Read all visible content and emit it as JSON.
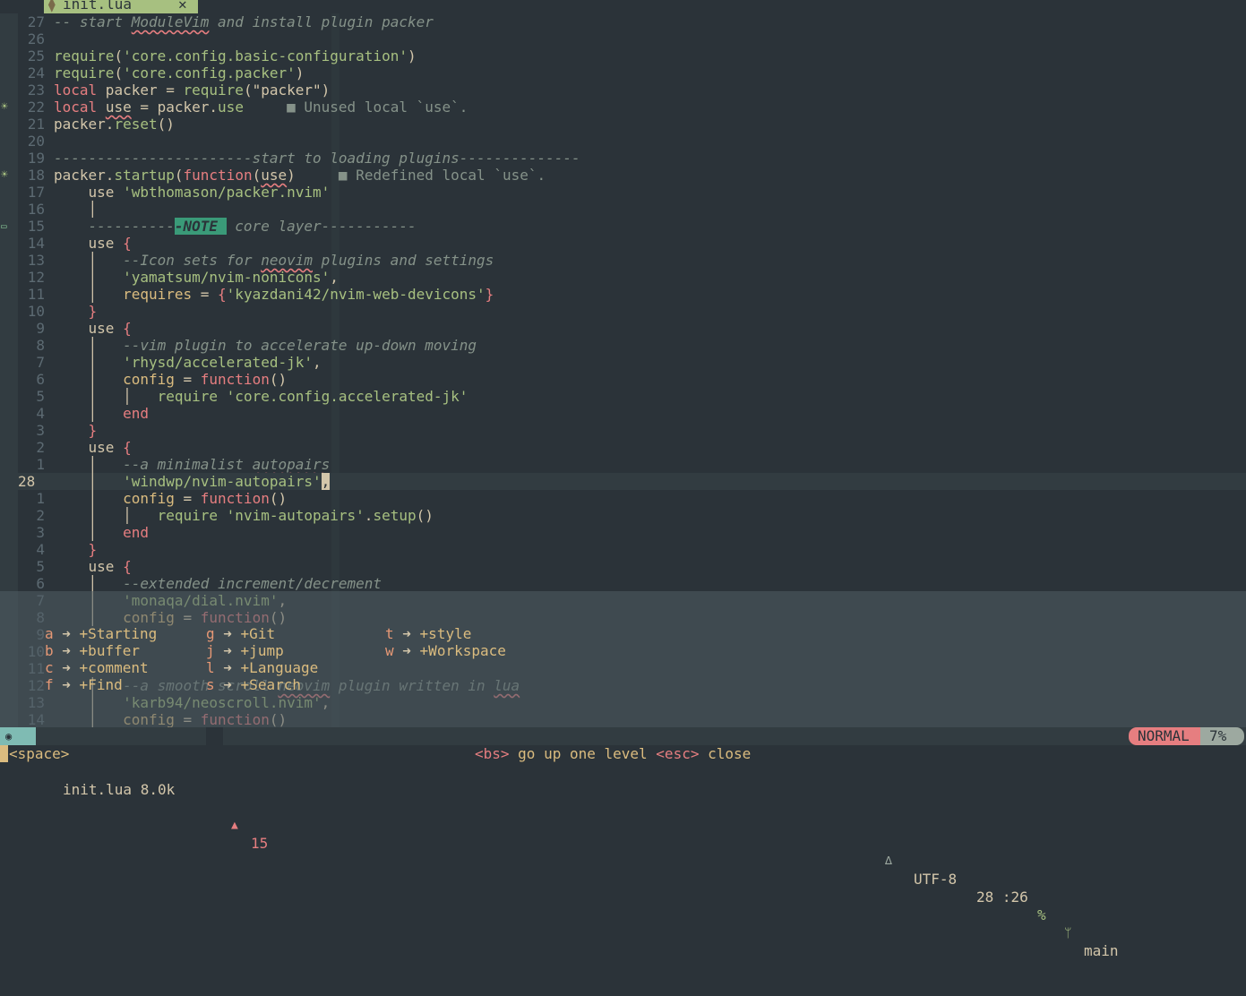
{
  "tab": {
    "icon": "lua-file-icon",
    "name": "init.lua",
    "close": "✕"
  },
  "lines": [
    {
      "num": "27",
      "sign": "",
      "segs": [
        [
          "cm",
          "-- start "
        ],
        [
          "cm uline",
          "ModuleVim"
        ],
        [
          "cm",
          " and install plugin packer"
        ]
      ]
    },
    {
      "num": "26",
      "sign": "",
      "segs": []
    },
    {
      "num": "25",
      "sign": "",
      "segs": [
        [
          "fn",
          "require"
        ],
        [
          "pl",
          "("
        ],
        [
          "str",
          "'core.config.basic-configuration'"
        ],
        [
          "pl",
          ")"
        ]
      ]
    },
    {
      "num": "24",
      "sign": "",
      "segs": [
        [
          "fn",
          "require"
        ],
        [
          "pl",
          "("
        ],
        [
          "str",
          "'core.config.packer'"
        ],
        [
          "pl",
          ")"
        ]
      ]
    },
    {
      "num": "23",
      "sign": "",
      "segs": [
        [
          "kw",
          "local"
        ],
        [
          "pl",
          " packer = "
        ],
        [
          "fn",
          "require"
        ],
        [
          "pl",
          "(\"packer\")"
        ]
      ]
    },
    {
      "num": "22",
      "sign": "☀",
      "segs": [
        [
          "kw",
          "local"
        ],
        [
          "pl",
          " "
        ],
        [
          "pl uline",
          "use"
        ],
        [
          "pl",
          " = packer."
        ],
        [
          "fn",
          "use"
        ],
        [
          "diag",
          "     ■ Unused local `use`."
        ]
      ]
    },
    {
      "num": "21",
      "sign": "",
      "segs": [
        [
          "pl",
          "packer."
        ],
        [
          "fn",
          "reset"
        ],
        [
          "pl",
          "()"
        ]
      ]
    },
    {
      "num": "20",
      "sign": "",
      "segs": []
    },
    {
      "num": "19",
      "sign": "",
      "segs": [
        [
          "cm",
          "-----------------------start to loading plugins--------------"
        ]
      ]
    },
    {
      "num": "18",
      "sign": "☀",
      "segs": [
        [
          "pl",
          "packer."
        ],
        [
          "fn",
          "startup"
        ],
        [
          "pl",
          "("
        ],
        [
          "kw",
          "function"
        ],
        [
          "pl",
          "("
        ],
        [
          "pl uline",
          "use"
        ],
        [
          "pl",
          ")"
        ],
        [
          "diag",
          "     ■ Redefined local `use`."
        ]
      ]
    },
    {
      "num": "17",
      "sign": "",
      "segs": [
        [
          "pl",
          "    use "
        ],
        [
          "str",
          "'wbthomason/packer.nvim'"
        ]
      ]
    },
    {
      "num": "16",
      "sign": "",
      "segs": [
        [
          "pl",
          "    │"
        ]
      ]
    },
    {
      "num": "15",
      "sign": "note",
      "segs": [
        [
          "pl",
          "    "
        ],
        [
          "cm",
          "----------"
        ],
        [
          "note",
          "-NOTE "
        ],
        [
          "cm",
          " core layer-----------"
        ]
      ]
    },
    {
      "num": "14",
      "sign": "",
      "segs": [
        [
          "pl",
          "    use "
        ],
        [
          "br",
          "{"
        ]
      ]
    },
    {
      "num": "13",
      "sign": "",
      "segs": [
        [
          "pl",
          "    │   "
        ],
        [
          "cm",
          "--Icon sets for "
        ],
        [
          "cm uline",
          "neovim"
        ],
        [
          "cm",
          " plugins and settings"
        ]
      ]
    },
    {
      "num": "12",
      "sign": "",
      "segs": [
        [
          "pl",
          "    │   "
        ],
        [
          "str",
          "'yamatsum/nvim-nonicons'"
        ],
        [
          "pl",
          ","
        ]
      ]
    },
    {
      "num": "11",
      "sign": "",
      "segs": [
        [
          "pl",
          "    │   "
        ],
        [
          "yl",
          "requires"
        ],
        [
          "pl",
          " = "
        ],
        [
          "br",
          "{"
        ],
        [
          "str",
          "'kyazdani42/nvim-web-devicons'"
        ],
        [
          "br",
          "}"
        ]
      ]
    },
    {
      "num": "10",
      "sign": "",
      "segs": [
        [
          "pl",
          "    "
        ],
        [
          "br",
          "}"
        ]
      ]
    },
    {
      "num": "9",
      "sign": "",
      "segs": [
        [
          "pl",
          "    use "
        ],
        [
          "br",
          "{"
        ]
      ]
    },
    {
      "num": "8",
      "sign": "",
      "segs": [
        [
          "pl",
          "    │   "
        ],
        [
          "cm",
          "--vim plugin to accelerate up-down moving"
        ]
      ]
    },
    {
      "num": "7",
      "sign": "",
      "segs": [
        [
          "pl",
          "    │   "
        ],
        [
          "str",
          "'rhysd/accelerated-jk'"
        ],
        [
          "pl",
          ","
        ]
      ]
    },
    {
      "num": "6",
      "sign": "",
      "segs": [
        [
          "pl",
          "    │   "
        ],
        [
          "yl",
          "config"
        ],
        [
          "pl",
          " = "
        ],
        [
          "kw",
          "function"
        ],
        [
          "pl",
          "()"
        ]
      ]
    },
    {
      "num": "5",
      "sign": "",
      "segs": [
        [
          "pl",
          "    │   │   "
        ],
        [
          "fn",
          "require"
        ],
        [
          "pl",
          " "
        ],
        [
          "str",
          "'core.config.accelerated-jk'"
        ]
      ]
    },
    {
      "num": "4",
      "sign": "",
      "segs": [
        [
          "pl",
          "    │   "
        ],
        [
          "kw",
          "end"
        ]
      ]
    },
    {
      "num": "3",
      "sign": "",
      "segs": [
        [
          "pl",
          "    "
        ],
        [
          "br",
          "}"
        ]
      ]
    },
    {
      "num": "2",
      "sign": "",
      "segs": [
        [
          "pl",
          "    use "
        ],
        [
          "br",
          "{"
        ]
      ]
    },
    {
      "num": "1",
      "sign": "",
      "segs": [
        [
          "pl",
          "    │   "
        ],
        [
          "cm",
          "--a minimalist "
        ],
        [
          "cm uline",
          "autopairs"
        ]
      ]
    },
    {
      "num": "28",
      "sign": "",
      "cur": true,
      "segs": [
        [
          "pl",
          "    │   "
        ],
        [
          "str",
          "'windwp/nvim-autopairs'"
        ],
        [
          "cursor",
          ","
        ]
      ]
    },
    {
      "num": "1",
      "sign": "",
      "segs": [
        [
          "pl",
          "    │   "
        ],
        [
          "yl",
          "config"
        ],
        [
          "pl",
          " = "
        ],
        [
          "kw",
          "function"
        ],
        [
          "pl",
          "()"
        ]
      ]
    },
    {
      "num": "2",
      "sign": "",
      "segs": [
        [
          "pl",
          "    │   │   "
        ],
        [
          "fn",
          "require"
        ],
        [
          "pl",
          " "
        ],
        [
          "str",
          "'nvim-autopairs'"
        ],
        [
          "pl",
          "."
        ],
        [
          "fn",
          "setup"
        ],
        [
          "pl",
          "()"
        ]
      ]
    },
    {
      "num": "3",
      "sign": "",
      "segs": [
        [
          "pl",
          "    │   "
        ],
        [
          "kw",
          "end"
        ]
      ]
    },
    {
      "num": "4",
      "sign": "",
      "segs": [
        [
          "pl",
          "    "
        ],
        [
          "br",
          "}"
        ]
      ]
    },
    {
      "num": "5",
      "sign": "",
      "segs": [
        [
          "pl",
          "    use "
        ],
        [
          "br",
          "{"
        ]
      ]
    },
    {
      "num": "6",
      "sign": "",
      "segs": [
        [
          "pl",
          "    │   "
        ],
        [
          "cm",
          "--extended increment/decrement"
        ]
      ]
    },
    {
      "num": "7",
      "sign": "",
      "segs": [
        [
          "pl",
          "    │   "
        ],
        [
          "str",
          "'monaqa/dial.nvim'"
        ],
        [
          "pl",
          ","
        ]
      ]
    },
    {
      "num": "8",
      "sign": "",
      "segs": [
        [
          "pl",
          "    │   "
        ],
        [
          "yl",
          "config"
        ],
        [
          "pl",
          " = "
        ],
        [
          "kw",
          "function"
        ],
        [
          "pl",
          "()"
        ]
      ]
    },
    {
      "num": "9",
      "sign": "",
      "segs": []
    },
    {
      "num": "10",
      "sign": "",
      "segs": []
    },
    {
      "num": "11",
      "sign": "",
      "segs": []
    },
    {
      "num": "12",
      "sign": "",
      "segs": [
        [
          "pl",
          "    │   "
        ],
        [
          "cm",
          "--a smooth scroll "
        ],
        [
          "cm uline",
          "neovim"
        ],
        [
          "cm",
          " plugin written in "
        ],
        [
          "cm uline",
          "lua"
        ]
      ]
    },
    {
      "num": "13",
      "sign": "",
      "segs": [
        [
          "pl",
          "    │   "
        ],
        [
          "str",
          "'karb94/neoscroll.nvim'"
        ],
        [
          "pl",
          ","
        ]
      ]
    },
    {
      "num": "14",
      "sign": "",
      "segs": [
        [
          "pl",
          "    │   "
        ],
        [
          "yl",
          "config"
        ],
        [
          "pl",
          " = "
        ],
        [
          "kw",
          "function"
        ],
        [
          "pl",
          "()"
        ]
      ]
    }
  ],
  "whichkey": {
    "arrow": "➜",
    "columns": [
      [
        {
          "key": "a",
          "desc": "+Starting"
        },
        {
          "key": "b",
          "desc": "+buffer"
        },
        {
          "key": "c",
          "desc": "+comment"
        },
        {
          "key": "f",
          "desc": "+Find"
        }
      ],
      [
        {
          "key": "g",
          "desc": "+Git"
        },
        {
          "key": "j",
          "desc": "+jump"
        },
        {
          "key": "l",
          "desc": "+Language"
        },
        {
          "key": "s",
          "desc": "+Search"
        }
      ],
      [
        {
          "key": "t",
          "desc": "+style"
        },
        {
          "key": "w",
          "desc": "+Workspace"
        }
      ]
    ]
  },
  "status": {
    "mode_icon": "◉",
    "filetype_icon": "⧫",
    "file": "init.lua 8.0k",
    "error_icon": "▲",
    "errors": "15",
    "os_icon": "🐧",
    "encoding": "UTF-8",
    "position": "28 :26",
    "percent_icon": "%",
    "branch_icon": "",
    "branch": "main",
    "mode": "NORMAL",
    "progress": "7%"
  },
  "cmdline": {
    "text": "<space>",
    "hint_bs_key": "<bs>",
    "hint_bs": " go up one level ",
    "hint_esc_key": "<esc>",
    "hint_esc": " close"
  },
  "colors": {
    "background": "#2b3339",
    "accent_green": "#a7c080",
    "accent_red": "#e67e80",
    "accent_yellow": "#dbbc7f"
  }
}
